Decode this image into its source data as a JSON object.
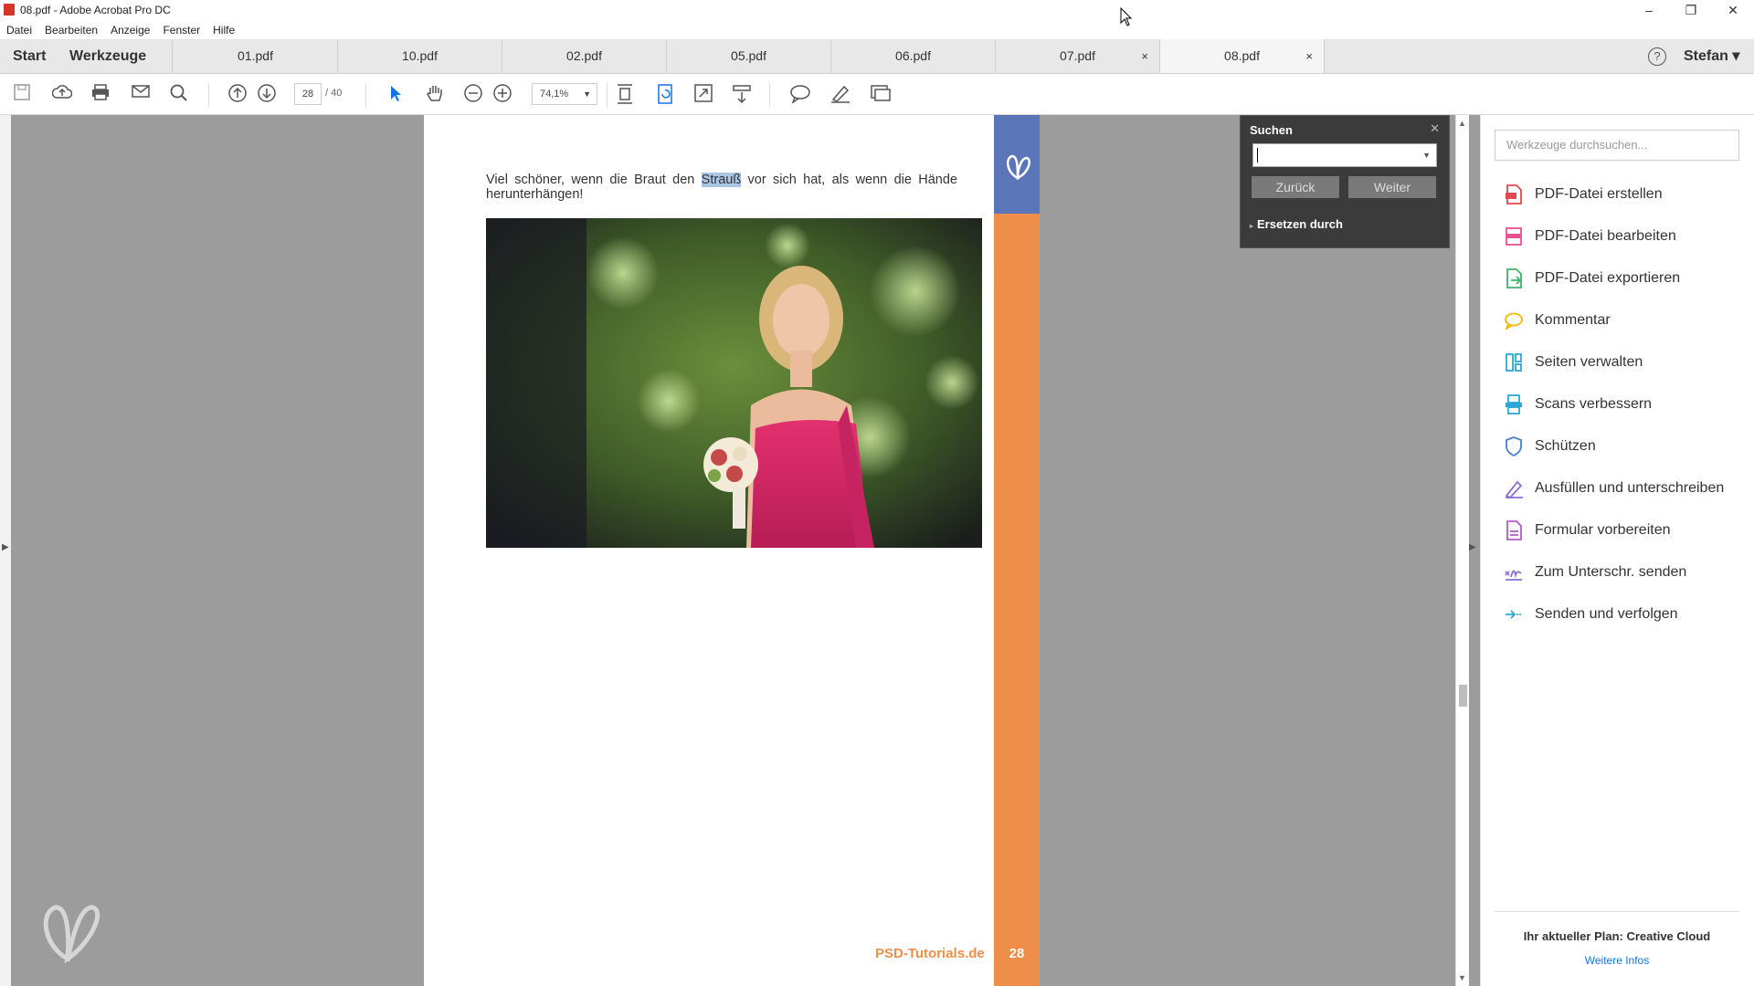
{
  "window": {
    "title": "08.pdf - Adobe Acrobat Pro DC",
    "controls": [
      "–",
      "❐",
      "✕"
    ]
  },
  "menu": [
    "Datei",
    "Bearbeiten",
    "Anzeige",
    "Fenster",
    "Hilfe"
  ],
  "tabs": {
    "start": "Start",
    "tools": "Werkzeuge",
    "documents": [
      {
        "label": "01.pdf",
        "closable": false,
        "active": false
      },
      {
        "label": "10.pdf",
        "closable": false,
        "active": false
      },
      {
        "label": "02.pdf",
        "closable": false,
        "active": false
      },
      {
        "label": "05.pdf",
        "closable": false,
        "active": false
      },
      {
        "label": "06.pdf",
        "closable": false,
        "active": false
      },
      {
        "label": "07.pdf",
        "closable": true,
        "active": false
      },
      {
        "label": "08.pdf",
        "closable": true,
        "active": true
      }
    ],
    "close_glyph": "×",
    "help": "?",
    "user": "Stefan ▾"
  },
  "toolbar": {
    "page_current": "28",
    "page_total": "/ 40",
    "zoom": "74,1%",
    "icons": [
      "save-icon",
      "upload-icon",
      "print-icon",
      "email-icon",
      "search-icon",
      "page-up-icon",
      "page-down-icon",
      "select-arrow-icon",
      "hand-icon",
      "zoom-out-icon",
      "zoom-in-icon",
      "fit-page-icon",
      "rotate-icon",
      "full-screen-icon",
      "scroll-mode-icon",
      "comment-icon",
      "highlight-pen-icon",
      "share-icon"
    ]
  },
  "document": {
    "text_before": "Viel schöner, wenn die Braut den ",
    "text_highlight": "Strauß",
    "text_after": " vor sich hat, als wenn die Hände herunterhängen!",
    "brand_orange": "PSD-",
    "brand_rest": "Tutorials.de",
    "page_badge": "28",
    "colors": {
      "band": "#ef8e4a",
      "band_top": "#5a75b8",
      "highlight": "#a9c6e4"
    }
  },
  "search_panel": {
    "title": "Suchen",
    "input_value": "",
    "back_label": "Zurück",
    "next_label": "Weiter",
    "replace_label": "Ersetzen durch"
  },
  "right_panel": {
    "search_placeholder": "Werkzeuge durchsuchen...",
    "tools": [
      {
        "label": "PDF-Datei erstellen",
        "icon": "pdf-create-icon",
        "color": "#e34850"
      },
      {
        "label": "PDF-Datei bearbeiten",
        "icon": "pdf-edit-icon",
        "color": "#e8508f"
      },
      {
        "label": "PDF-Datei exportieren",
        "icon": "pdf-export-icon",
        "color": "#3cb56b"
      },
      {
        "label": "Kommentar",
        "icon": "comment-tool-icon",
        "color": "#f5b800"
      },
      {
        "label": "Seiten verwalten",
        "icon": "pages-icon",
        "color": "#2ba8d8"
      },
      {
        "label": "Scans verbessern",
        "icon": "scan-icon",
        "color": "#2ba8d8"
      },
      {
        "label": "Schützen",
        "icon": "shield-icon",
        "color": "#4a7fd1"
      },
      {
        "label": "Ausfüllen und unterschreiben",
        "icon": "fill-sign-icon",
        "color": "#8a6fd6"
      },
      {
        "label": "Formular vorbereiten",
        "icon": "form-icon",
        "color": "#b05ec2"
      },
      {
        "label": "Zum Unterschr. senden",
        "icon": "send-sign-icon",
        "color": "#8a6fd6"
      },
      {
        "label": "Senden und verfolgen",
        "icon": "send-track-icon",
        "color": "#2ba8d8"
      }
    ],
    "plan": "Ihr aktueller Plan: Creative Cloud",
    "more_info": "Weitere Infos"
  }
}
